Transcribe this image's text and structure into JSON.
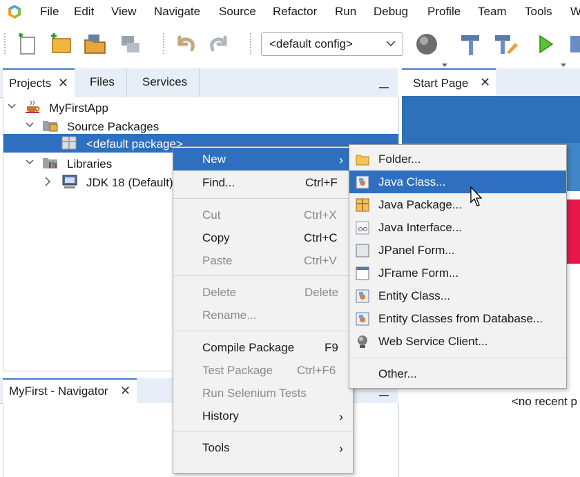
{
  "menubar": {
    "items": [
      "File",
      "Edit",
      "View",
      "Navigate",
      "Source",
      "Refactor",
      "Run",
      "Debug",
      "Profile",
      "Team",
      "Tools",
      "W"
    ]
  },
  "toolbar": {
    "config": "<default config>"
  },
  "projects_panel": {
    "tabs": [
      "Projects",
      "Files",
      "Services"
    ],
    "tree": {
      "project": "MyFirstApp",
      "source_packages": "Source Packages",
      "default_package": "<default package>",
      "libraries": "Libraries",
      "jdk": "JDK 18 (Default)"
    }
  },
  "navigator": {
    "title": "MyFirst - Navigator"
  },
  "editor": {
    "tab": "Start Page",
    "no_recent": "<no recent p"
  },
  "context_menu": {
    "items": [
      {
        "label": "New",
        "shortcut": ""
      },
      {
        "label": "Find...",
        "shortcut": "Ctrl+F"
      },
      {
        "label": "Cut",
        "shortcut": "Ctrl+X"
      },
      {
        "label": "Copy",
        "shortcut": "Ctrl+C"
      },
      {
        "label": "Paste",
        "shortcut": "Ctrl+V"
      },
      {
        "label": "Delete",
        "shortcut": "Delete"
      },
      {
        "label": "Rename...",
        "shortcut": ""
      },
      {
        "label": "Compile Package",
        "shortcut": "F9"
      },
      {
        "label": "Test Package",
        "shortcut": "Ctrl+F6"
      },
      {
        "label": "Run Selenium Tests",
        "shortcut": ""
      },
      {
        "label": "History",
        "shortcut": ""
      },
      {
        "label": "Tools",
        "shortcut": ""
      }
    ]
  },
  "submenu_new": {
    "items": [
      "Folder...",
      "Java Class...",
      "Java Package...",
      "Java Interface...",
      "JPanel Form...",
      "JFrame Form...",
      "Entity Class...",
      "Entity Classes from Database...",
      "Web Service Client...",
      "Other..."
    ]
  },
  "colors": {
    "selection": "#2f6fbf",
    "tab_accent": "#3b7bd4"
  }
}
